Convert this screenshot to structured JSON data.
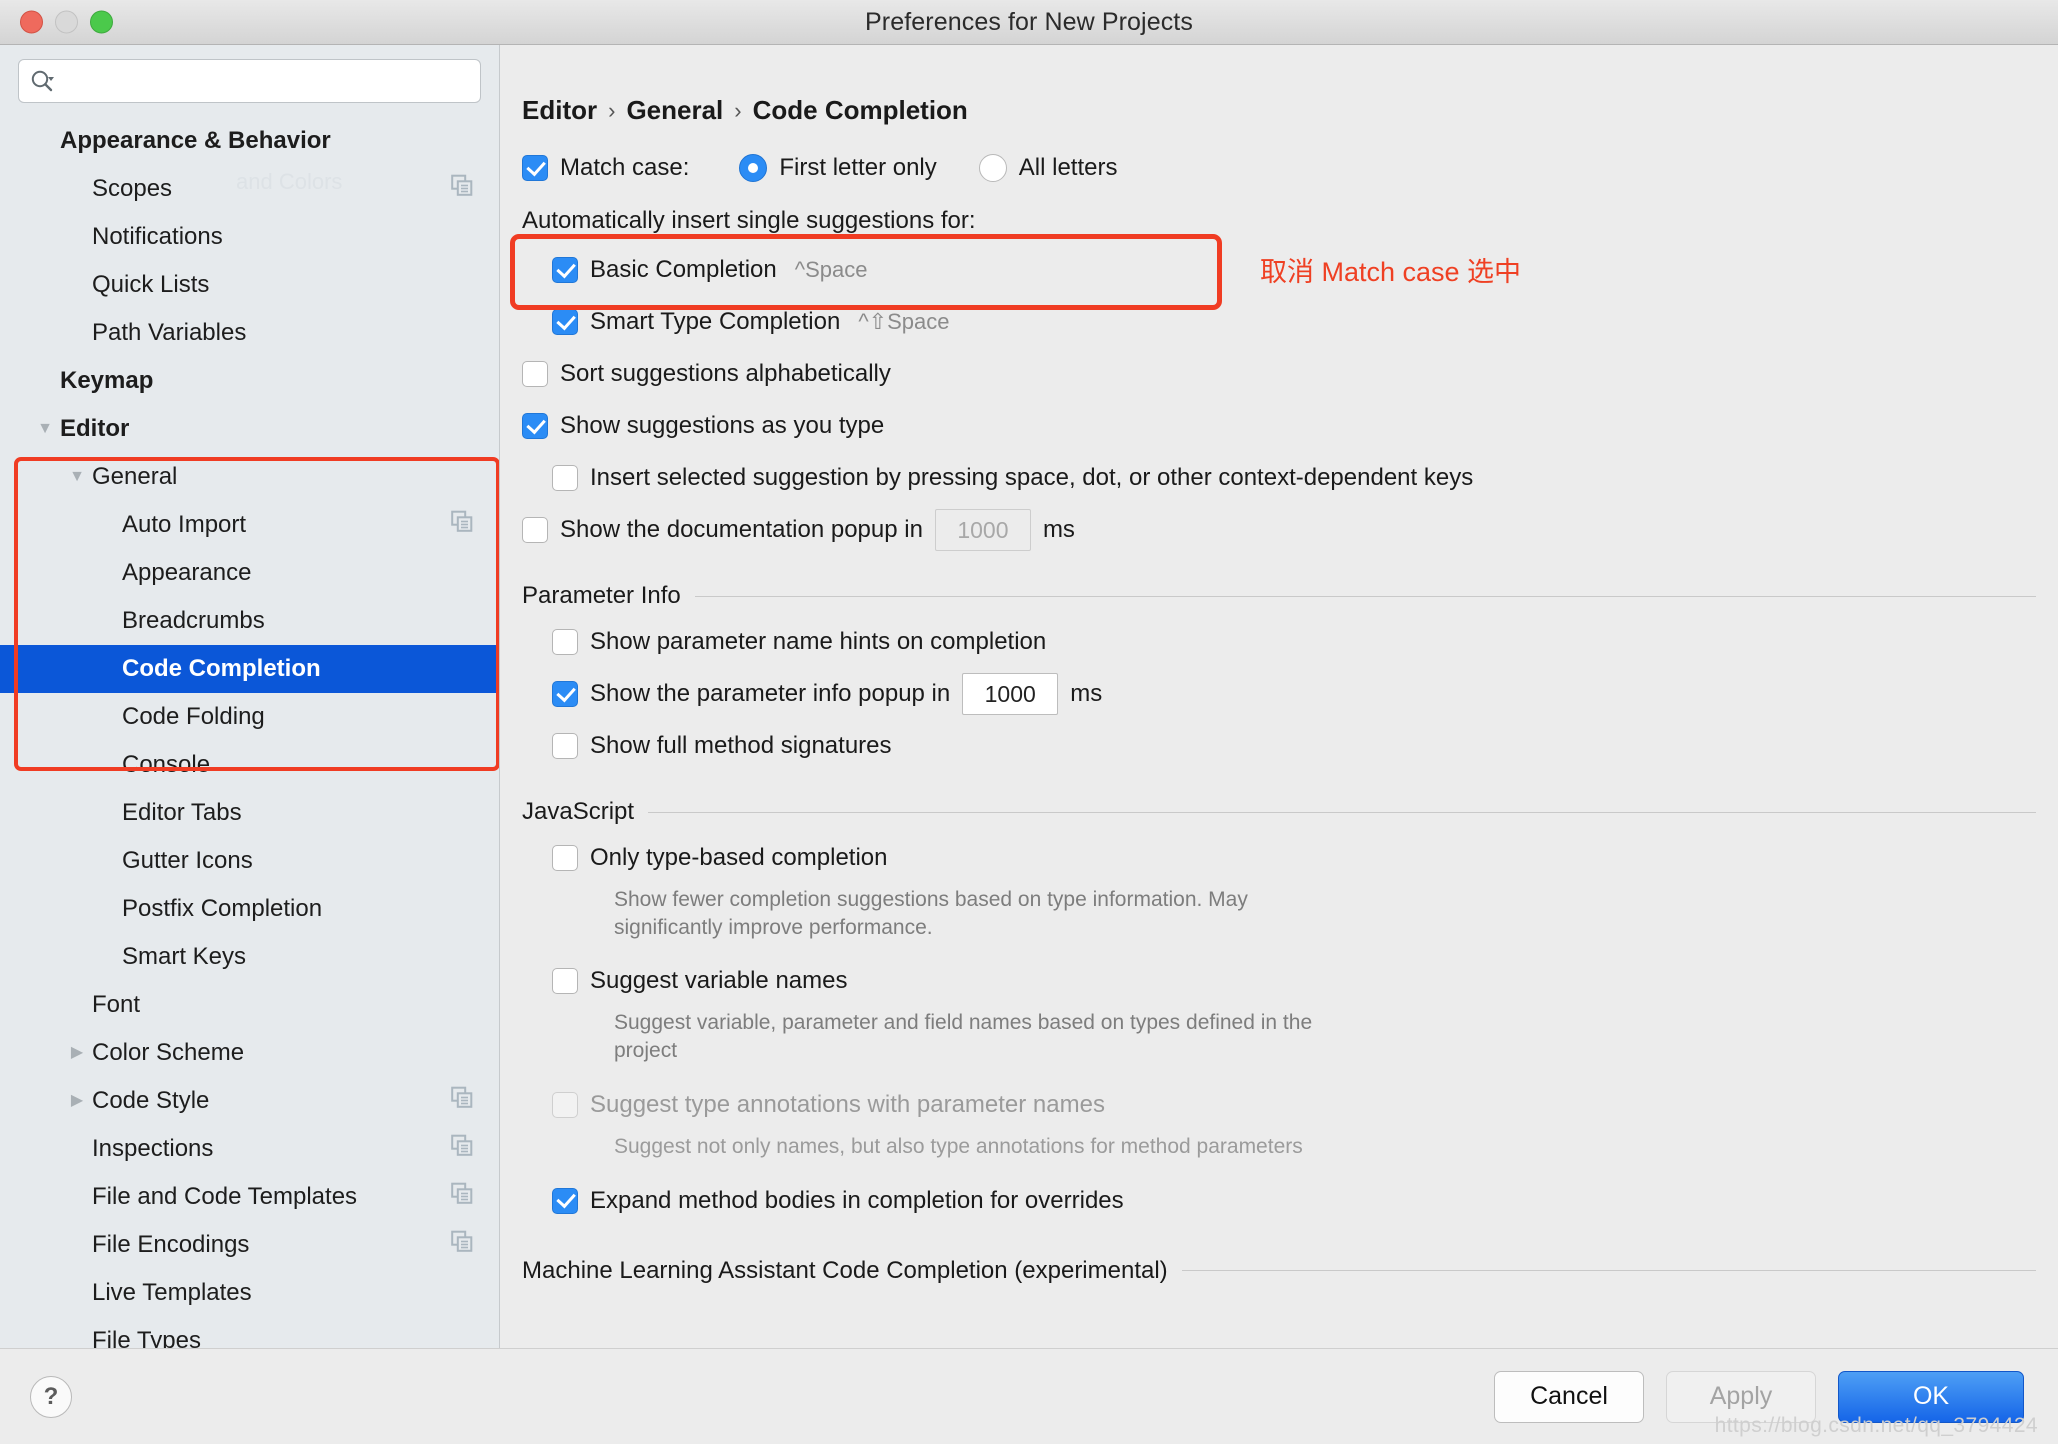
{
  "window": {
    "title": "Preferences for New Projects",
    "traffic_lights": [
      "close",
      "minimize",
      "zoom"
    ]
  },
  "search": {
    "value": "",
    "placeholder": ""
  },
  "sidebar": {
    "items": [
      {
        "label": "Appearance & Behavior",
        "level": "top",
        "bold": true,
        "twisty": "",
        "copy": false,
        "selected": false
      },
      {
        "label": "Scopes",
        "level": "lvl2",
        "bold": false,
        "twisty": "",
        "copy": true,
        "selected": false
      },
      {
        "label": "Notifications",
        "level": "lvl2",
        "bold": false,
        "twisty": "",
        "copy": false,
        "selected": false
      },
      {
        "label": "Quick Lists",
        "level": "lvl2",
        "bold": false,
        "twisty": "",
        "copy": false,
        "selected": false
      },
      {
        "label": "Path Variables",
        "level": "lvl2",
        "bold": false,
        "twisty": "",
        "copy": false,
        "selected": false
      },
      {
        "label": "Keymap",
        "level": "top",
        "bold": true,
        "twisty": "",
        "copy": false,
        "selected": false
      },
      {
        "label": "Editor",
        "level": "top",
        "bold": true,
        "twisty": "▼",
        "copy": false,
        "selected": false
      },
      {
        "label": "General",
        "level": "lvl2",
        "bold": false,
        "twisty": "▼",
        "copy": false,
        "selected": false
      },
      {
        "label": "Auto Import",
        "level": "lvl3",
        "bold": false,
        "twisty": "",
        "copy": true,
        "selected": false
      },
      {
        "label": "Appearance",
        "level": "lvl3",
        "bold": false,
        "twisty": "",
        "copy": false,
        "selected": false
      },
      {
        "label": "Breadcrumbs",
        "level": "lvl3",
        "bold": false,
        "twisty": "",
        "copy": false,
        "selected": false
      },
      {
        "label": "Code Completion",
        "level": "lvl3",
        "bold": true,
        "twisty": "",
        "copy": false,
        "selected": true
      },
      {
        "label": "Code Folding",
        "level": "lvl3",
        "bold": false,
        "twisty": "",
        "copy": false,
        "selected": false
      },
      {
        "label": "Console",
        "level": "lvl3",
        "bold": false,
        "twisty": "",
        "copy": false,
        "selected": false
      },
      {
        "label": "Editor Tabs",
        "level": "lvl3",
        "bold": false,
        "twisty": "",
        "copy": false,
        "selected": false
      },
      {
        "label": "Gutter Icons",
        "level": "lvl3",
        "bold": false,
        "twisty": "",
        "copy": false,
        "selected": false
      },
      {
        "label": "Postfix Completion",
        "level": "lvl3",
        "bold": false,
        "twisty": "",
        "copy": false,
        "selected": false
      },
      {
        "label": "Smart Keys",
        "level": "lvl3",
        "bold": false,
        "twisty": "",
        "copy": false,
        "selected": false
      },
      {
        "label": "Font",
        "level": "lvl2",
        "bold": false,
        "twisty": "",
        "copy": false,
        "selected": false
      },
      {
        "label": "Color Scheme",
        "level": "lvl2",
        "bold": false,
        "twisty": "▶",
        "copy": false,
        "selected": false
      },
      {
        "label": "Code Style",
        "level": "lvl2",
        "bold": false,
        "twisty": "▶",
        "copy": true,
        "selected": false
      },
      {
        "label": "Inspections",
        "level": "lvl2",
        "bold": false,
        "twisty": "",
        "copy": true,
        "selected": false
      },
      {
        "label": "File and Code Templates",
        "level": "lvl2",
        "bold": false,
        "twisty": "",
        "copy": true,
        "selected": false
      },
      {
        "label": "File Encodings",
        "level": "lvl2",
        "bold": false,
        "twisty": "",
        "copy": true,
        "selected": false
      },
      {
        "label": "Live Templates",
        "level": "lvl2",
        "bold": false,
        "twisty": "",
        "copy": false,
        "selected": false
      },
      {
        "label": "File Types",
        "level": "lvl2",
        "bold": false,
        "twisty": "",
        "copy": false,
        "selected": false
      }
    ],
    "ghost_text": "and Colors"
  },
  "breadcrumb": {
    "part1": "Editor",
    "sep1": "›",
    "part2": "General",
    "sep2": "›",
    "part3": "Code Completion"
  },
  "annotation": {
    "text": "取消 Match case 选中",
    "color": "#ef4023"
  },
  "main": {
    "match_case": {
      "checked": true,
      "label": "Match case:",
      "radio_first_letter": {
        "label": "First letter only",
        "selected": true
      },
      "radio_all_letters": {
        "label": "All letters",
        "selected": false
      }
    },
    "auto_insert_header": "Automatically insert single suggestions for:",
    "basic_completion": {
      "label": "Basic Completion",
      "shortcut": "^Space",
      "checked": true
    },
    "smart_type": {
      "label": "Smart Type Completion",
      "shortcut": "^⇧Space",
      "checked": true
    },
    "sort_alpha": {
      "label": "Sort suggestions alphabetically",
      "checked": false
    },
    "show_as_type": {
      "label": "Show suggestions as you type",
      "checked": true
    },
    "insert_selected": {
      "label": "Insert selected suggestion by pressing space, dot, or other context-dependent keys",
      "checked": false
    },
    "doc_popup": {
      "label": "Show the documentation popup in",
      "checked": false,
      "value": "1000",
      "unit": "ms",
      "disabled": true
    },
    "parameter_info": {
      "title": "Parameter Info",
      "show_hints": {
        "label": "Show parameter name hints on completion",
        "checked": false
      },
      "popup_delay": {
        "label": "Show the parameter info popup in",
        "checked": true,
        "value": "1000",
        "unit": "ms"
      },
      "full_signatures": {
        "label": "Show full method signatures",
        "checked": false
      }
    },
    "javascript": {
      "title": "JavaScript",
      "only_type_based": {
        "label": "Only type-based completion",
        "checked": false,
        "desc": "Show fewer completion suggestions based on type information. May significantly improve performance."
      },
      "suggest_var_names": {
        "label": "Suggest variable names",
        "checked": false,
        "desc": "Suggest variable, parameter and field names based on types defined in the project"
      },
      "suggest_type_annotations": {
        "label": "Suggest type annotations with parameter names",
        "checked": false,
        "disabled": true,
        "desc": "Suggest not only names, but also type annotations for method parameters"
      },
      "expand_method_bodies": {
        "label": "Expand method bodies in completion for overrides",
        "checked": true
      }
    },
    "ml_section": {
      "title": "Machine Learning Assistant Code Completion (experimental)"
    }
  },
  "footer": {
    "help": "?",
    "cancel": "Cancel",
    "apply": "Apply",
    "ok": "OK"
  },
  "watermark": "https://blog.csdn.net/qq_3794424"
}
